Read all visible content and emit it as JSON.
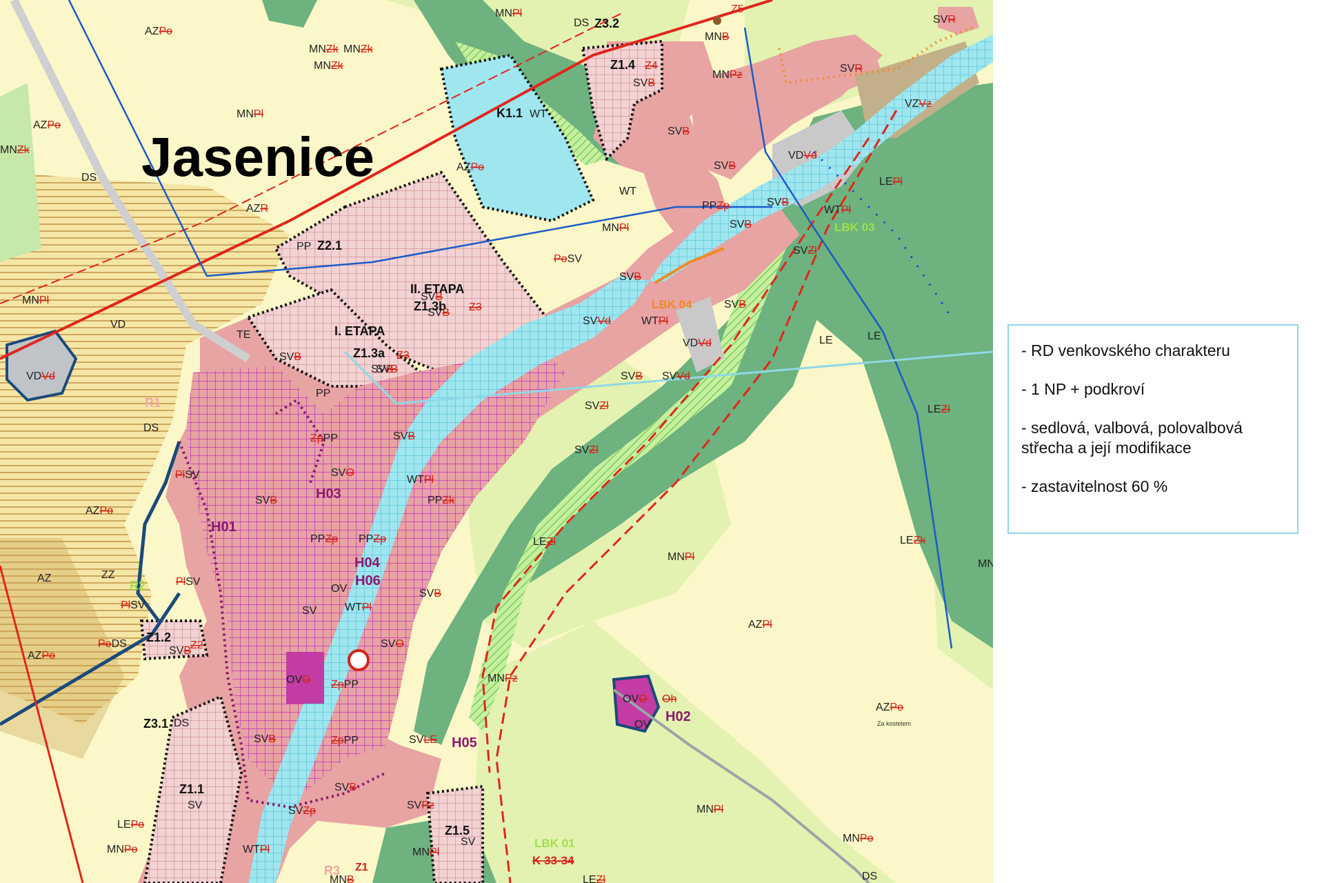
{
  "map": {
    "town_name": "Jasenice",
    "stage_labels": [
      "II. ETAPA",
      "I. ETAPA"
    ],
    "zone_ids": [
      "Z1.3b",
      "Z1.3a",
      "Z2.1",
      "K1.1",
      "Z1.4",
      "Z3.2",
      "Z1.2",
      "Z3.1",
      "Z1.1",
      "Z1.5"
    ],
    "h_labels": [
      "H01",
      "H02",
      "H03",
      "H04",
      "H05",
      "H06"
    ],
    "corridors": [
      "LBK 03",
      "LBK 04",
      "LBK 01",
      "K 33-34"
    ],
    "regions": [
      "R1",
      "R3",
      "R2"
    ],
    "area_codes": {
      "sv": "SV",
      "az": "AZ",
      "mn": "MN",
      "le": "LE",
      "pp": "PP",
      "vd": "VD",
      "wt": "WT",
      "ds": "DS",
      "ov": "OV",
      "vz": "VZ",
      "te": "TE",
      "zz": "ZZ",
      "b": "B",
      "zk": "Zk",
      "po": "Po",
      "pl": "Pl",
      "zl": "Zl",
      "vd2": "Vd",
      "zp": "Zp",
      "z4": "Z4",
      "z3": "Z3",
      "z2": "Z2",
      "z1": "Z1",
      "z5": "Z5",
      "r": "R",
      "vz2": "Vz",
      "pz": "Pz",
      "oh": "Oh",
      "o": "O",
      "le2": "LE"
    },
    "place_note": "Za kostelem",
    "colors": {
      "field": "#fbf7c8",
      "meadow": "#e3f2b0",
      "forest": "#6db27f",
      "residential": "#e8a3a3",
      "water": "#9fe6ef",
      "magenta": "#e36ad8",
      "border_red": "#e0261c",
      "callout": "#8fd8e6"
    }
  },
  "legend": {
    "items": [
      "- RD venkovského charakteru",
      "- 1 NP + podkroví",
      "- sedlová, valbová, polovalbová střecha a její modifikace",
      "- zastavitelnost 60 %"
    ]
  }
}
